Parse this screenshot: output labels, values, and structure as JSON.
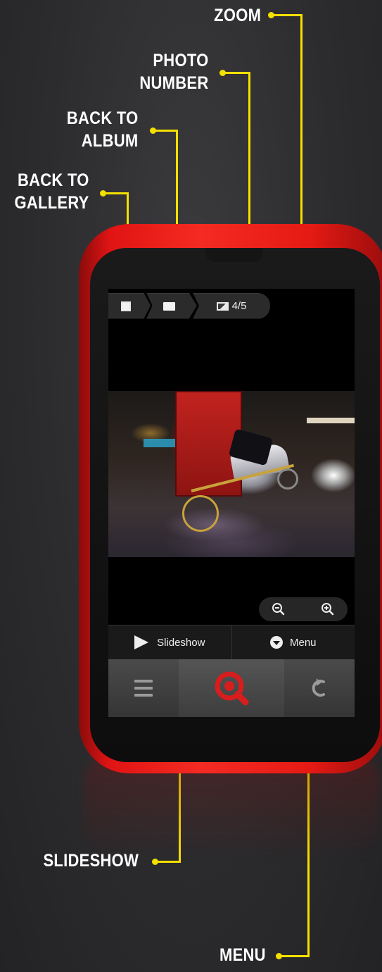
{
  "callouts": {
    "zoom": "ZOOM",
    "photo_number": "PHOTO\nNUMBER",
    "back_to_album": "BACK TO\nALBUM",
    "back_to_gallery": "BACK TO\nGALLERY",
    "slideshow": "SLIDESHOW",
    "menu": "MENU"
  },
  "breadcrumb": {
    "gallery_icon": "gallery-icon",
    "album_icon": "album-icon",
    "image_icon": "image-icon",
    "photo_number": "4/5"
  },
  "zoom_controls": {
    "zoom_out_icon": "zoom-out-icon",
    "zoom_in_icon": "zoom-in-icon"
  },
  "action_bar": {
    "slideshow_label": "Slideshow",
    "menu_label": "Menu"
  },
  "nav_bar": {
    "left_icon": "hamburger-icon",
    "center_icon": "search-icon",
    "right_icon": "back-icon"
  },
  "colors": {
    "accent_yellow": "#f5e000",
    "phone_red": "#e51a14",
    "background": "#2c2c2e"
  }
}
